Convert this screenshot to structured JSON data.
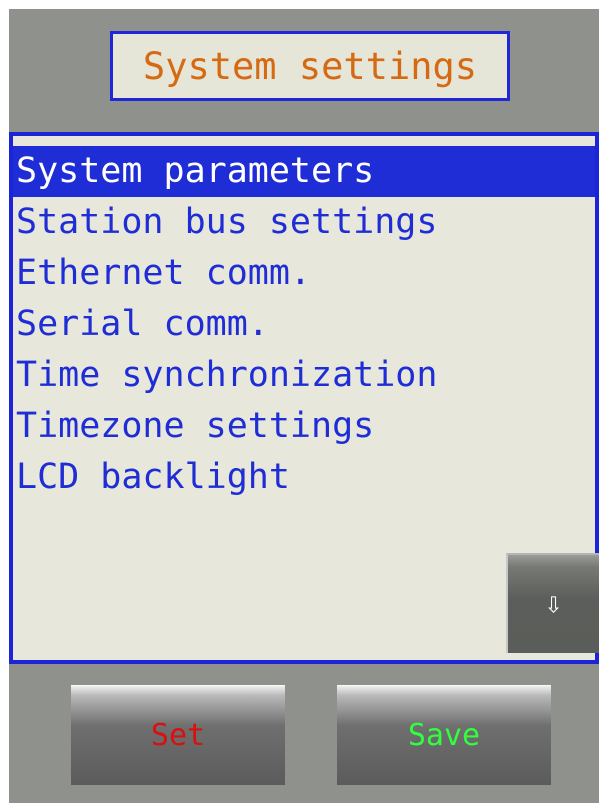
{
  "header": {
    "title": "System settings"
  },
  "menu": {
    "items": [
      {
        "label": "System parameters",
        "selected": true
      },
      {
        "label": "Station bus settings",
        "selected": false
      },
      {
        "label": "Ethernet comm.",
        "selected": false
      },
      {
        "label": "Serial comm.",
        "selected": false
      },
      {
        "label": "Time synchronization",
        "selected": false
      },
      {
        "label": "Timezone settings",
        "selected": false
      },
      {
        "label": "LCD backlight",
        "selected": false
      }
    ]
  },
  "controls": {
    "scroll_down_icon": "⇩",
    "set_label": "Set",
    "save_label": "Save"
  },
  "colors": {
    "screen_background": "#8f918c",
    "panel_background": "#e7e7db",
    "accent_blue": "#1f2dd6",
    "title_text": "#d56a12",
    "set_text": "#d8100f",
    "save_text": "#30ff40"
  },
  "icons": {
    "scroll_down": "down-arrow-icon"
  }
}
